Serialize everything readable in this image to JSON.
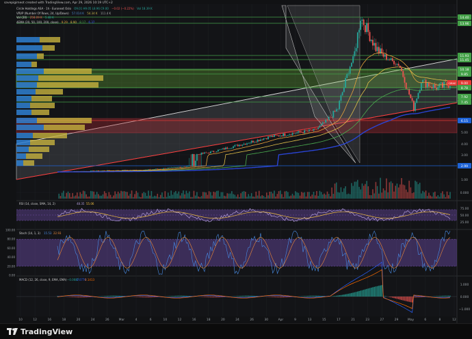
{
  "credit": "savepigimeot created with TradingView.com, Apr 29, 2026 10:19 UTC+2",
  "legend": {
    "main": [
      "Circle Holdings ASA · 1h · Euronext Oslo",
      "O9.01 H9.05 L8.96 C9.00",
      "−0.02 (−0.22%)",
      "Vol 18.39 K"
    ],
    "vrvp": [
      "VRVP (Number Of Rows, 24, Up/Down)",
      "57.014 K",
      "54.34 K",
      "111.4 K"
    ],
    "vol": [
      "Vol (20)",
      "258.09 K",
      "5.48 K"
    ],
    "ema": [
      "4EMA (20, 50, 100, 200, close)",
      "9.29",
      "8.90",
      "8.17",
      "6.37"
    ]
  },
  "price_labels": [
    {
      "text": "14.40",
      "bg": "#43a047"
    },
    {
      "text": "13.96",
      "bg": "#43a047"
    },
    {
      "text": "11.93",
      "bg": "#43a047"
    },
    {
      "text": "11.45",
      "bg": "#43a047"
    },
    {
      "text": "10.18",
      "bg": "#43a047"
    },
    {
      "text": "9.85",
      "bg": "#43a047"
    },
    {
      "text": "9.00",
      "bg": "#e53935"
    },
    {
      "text": "8.78",
      "bg": "#43a047"
    },
    {
      "text": "7.92",
      "bg": "#43a047"
    },
    {
      "text": "7.45",
      "bg": "#43a047"
    },
    {
      "text": "6.15",
      "bg": "#1e63d6"
    },
    {
      "text": "2.99",
      "bg": "#1e63d6"
    }
  ],
  "current_tag": "CIRHE",
  "axis_plain": [
    "6.00",
    "5.00",
    "4.00",
    "3.00",
    "1.00",
    "0.000"
  ],
  "rsi": {
    "label": "RSI (14, close, SMA, 14, 2)",
    "v1": "48.35",
    "v2": "55.06",
    "ticks": [
      "75.00",
      "50.00",
      "25.00"
    ]
  },
  "stoch": {
    "label": "Stoch (14, 1, 3)",
    "v1": "15.53",
    "v2": "22.93",
    "ticks": [
      "100.00",
      "80.00",
      "60.00",
      "40.00",
      "20.00",
      "0.00"
    ]
  },
  "macd": {
    "label": "MACD (12, 26, close, 9, EMA, EMA)",
    "v1": "−0.0687",
    "v2": "0.0776",
    "v3": "0.1413",
    "ticks": [
      "1.000",
      "0.000",
      "−1.000"
    ]
  },
  "xaxis": [
    "10",
    "12",
    "16",
    "18",
    "20",
    "24",
    "26",
    "Mar",
    "4",
    "6",
    "10",
    "12",
    "16",
    "18",
    "20",
    "24",
    "26",
    "30",
    "Apr",
    "9",
    "13",
    "15",
    "17",
    "21",
    "23",
    "27",
    "29",
    "May",
    "6",
    "8",
    "12"
  ],
  "brand": "TradingView",
  "colors": {
    "bull": "#26a69a",
    "bear": "#ef5350",
    "ema200": "#2a44d4",
    "accent": "#43a047"
  }
}
